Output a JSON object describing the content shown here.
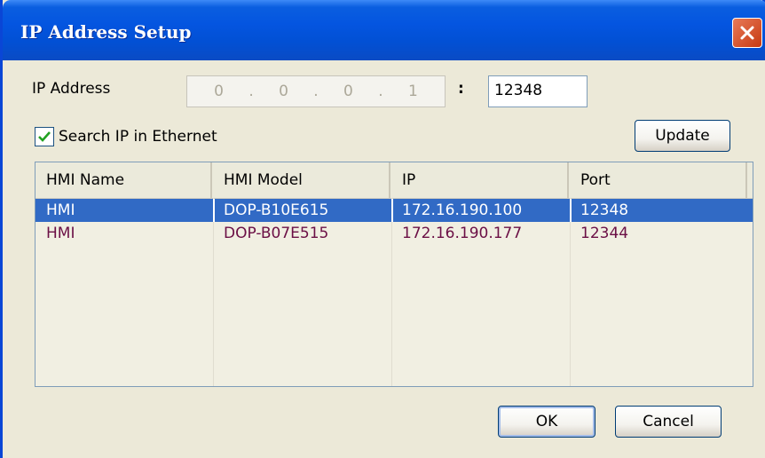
{
  "window": {
    "title": "IP Address Setup"
  },
  "ip_address": {
    "label": "IP Address",
    "octets": [
      "0",
      ".",
      "0",
      ".",
      "0",
      ".",
      "1"
    ],
    "colon": ":",
    "port": "12348"
  },
  "search": {
    "label": "Search IP in Ethernet",
    "checked": true
  },
  "buttons": {
    "update": "Update",
    "ok": "OK",
    "cancel": "Cancel"
  },
  "table": {
    "columns": [
      "HMI Name",
      "HMI Model",
      "IP",
      "Port"
    ],
    "rows": [
      {
        "name": "HMI",
        "model": "DOP-B10E615",
        "ip": "172.16.190.100",
        "port": "12348",
        "selected": true
      },
      {
        "name": "HMI",
        "model": "DOP-B07E515",
        "ip": "172.16.190.177",
        "port": "12344",
        "selected": false
      }
    ]
  },
  "colors": {
    "title_bar": "#0455e0",
    "selection": "#316ac5",
    "row_text": "#6b0f45",
    "dialog_bg": "#ece9d8"
  }
}
